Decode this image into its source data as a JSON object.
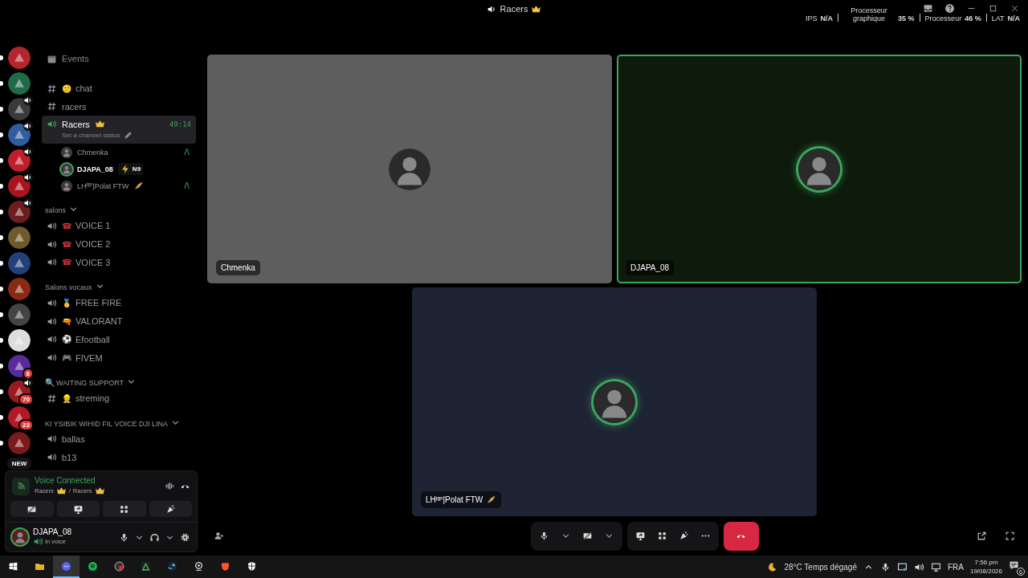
{
  "window": {
    "title": "Racers",
    "title_crown": true
  },
  "perf_stats": [
    {
      "label": "IPS",
      "value": "N/A"
    },
    {
      "label": "Processeur graphique",
      "value": "35 %"
    },
    {
      "label": "Processeur",
      "value": "46 %"
    },
    {
      "label": "LAT",
      "value": "N/A"
    }
  ],
  "servers": [
    {
      "color": "#b3262e",
      "unread": true,
      "in_voice": false
    },
    {
      "color": "#1f6b45",
      "unread": true,
      "in_voice": false
    },
    {
      "color": "#3a3a3a",
      "unread": true,
      "in_voice": true
    },
    {
      "color": "#2f5d9e",
      "unread": true,
      "in_voice": true
    },
    {
      "color": "#c01f2a",
      "unread": true,
      "in_voice": true
    },
    {
      "color": "#a8141e",
      "unread": true,
      "in_voice": true
    },
    {
      "color": "#6b1d20",
      "unread": true,
      "in_voice": true
    },
    {
      "color": "#6e5a2a",
      "unread": true,
      "in_voice": false
    },
    {
      "color": "#24407a",
      "unread": true,
      "in_voice": false
    },
    {
      "color": "#8a2a12",
      "unread": true,
      "in_voice": false
    },
    {
      "color": "#444444",
      "unread": true,
      "in_voice": false
    },
    {
      "color": "#dddddd",
      "unread": true,
      "in_voice": false
    },
    {
      "color": "#5a2a9a",
      "unread": true,
      "in_voice": false,
      "badge": "8"
    },
    {
      "color": "#9a1a22",
      "unread": true,
      "in_voice": true,
      "badge": "70"
    },
    {
      "color": "#b01a24",
      "unread": true,
      "in_voice": false,
      "badge": "23"
    },
    {
      "color": "#7a1a1a",
      "unread": true,
      "in_voice": false,
      "badge": "NEW"
    }
  ],
  "channels": [
    {
      "kind": "event",
      "name": "Events"
    },
    {
      "kind": "text",
      "name": "chat",
      "emoji": "🙂"
    },
    {
      "kind": "text",
      "name": "racers"
    },
    {
      "kind": "voice",
      "name": "Racers",
      "crown": true,
      "selected": true,
      "status": "Set a channel status",
      "timer": "49:14",
      "members": [
        {
          "name": "Chmenka",
          "speaking": false,
          "indicator": "Λ"
        },
        {
          "name": "DJAPA_08",
          "speaking": true,
          "tag": "N9"
        },
        {
          "name": "LHᴿᴾ|Polat FTW",
          "speaking": false,
          "feather": true,
          "indicator": "Λ"
        }
      ]
    },
    {
      "kind": "category",
      "name": "salons"
    },
    {
      "kind": "voice",
      "name": "VOICE 1",
      "emoji": "☎",
      "selected": false
    },
    {
      "kind": "voice",
      "name": "VOICE 2",
      "emoji": "☎",
      "selected": false
    },
    {
      "kind": "voice",
      "name": "VOICE 3",
      "emoji": "☎",
      "selected": false
    },
    {
      "kind": "category",
      "name": "Salons vocaux"
    },
    {
      "kind": "voice",
      "name": "FREE FIRE",
      "emoji": "🥇",
      "selected": false
    },
    {
      "kind": "voice",
      "name": "VALORANT",
      "emoji": "🔫",
      "selected": false
    },
    {
      "kind": "voice",
      "name": "Efootball",
      "emoji": "⚽",
      "selected": false
    },
    {
      "kind": "voice",
      "name": "FIVEM",
      "emoji": "🎮",
      "selected": false
    },
    {
      "kind": "category",
      "name": "WAITING SUPPORT",
      "emoji": "🔍"
    },
    {
      "kind": "text",
      "name": "streming",
      "emoji": "👷"
    },
    {
      "kind": "category",
      "name": "KI YSIBIK WIHID FIL VOICE DJI LINA"
    },
    {
      "kind": "voice",
      "name": "ballas",
      "selected": false
    },
    {
      "kind": "voice",
      "name": "b13",
      "selected": false
    }
  ],
  "voice_panel": {
    "title": "Voice Connected",
    "path": [
      "Racers",
      "Racers"
    ],
    "separator": "/"
  },
  "user_panel": {
    "name": "DJAPA_08",
    "status": "In voice"
  },
  "tiles": [
    {
      "name": "Chmenka",
      "color": "#5e5e5e",
      "speaking": false,
      "focused": false
    },
    {
      "name": "DJAPA_08",
      "color": "#0e1a0b",
      "speaking": true,
      "focused": true
    },
    {
      "name": "LHᴿᴾ|Polat FTW",
      "color": "#1e2434",
      "speaking": true,
      "focused": false,
      "feather": true
    }
  ],
  "taskbar": {
    "apps": [
      {
        "kind": "explorer",
        "selected": false
      },
      {
        "kind": "discord",
        "selected": true
      },
      {
        "kind": "spotify",
        "selected": false
      },
      {
        "kind": "obs",
        "selected": false
      },
      {
        "kind": "game",
        "selected": false
      },
      {
        "kind": "steam",
        "selected": false
      },
      {
        "kind": "webcam",
        "selected": false
      },
      {
        "kind": "brave",
        "selected": false
      },
      {
        "kind": "shield",
        "selected": false
      }
    ],
    "weather": "28°C  Temps dégagé",
    "language": "FRA",
    "time": "7:56 pm",
    "date": "19/08/2026",
    "notifications": "6"
  }
}
